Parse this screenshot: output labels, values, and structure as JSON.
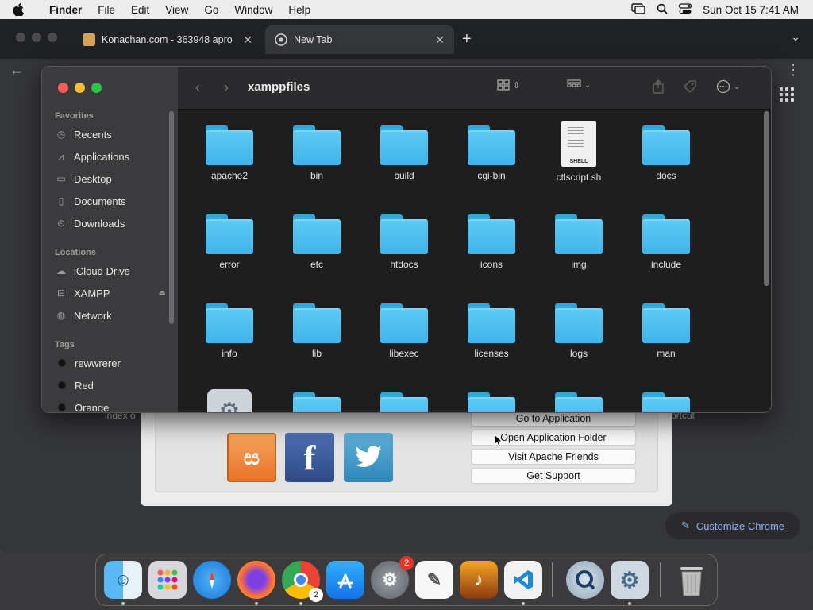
{
  "menubar": {
    "app_name": "Finder",
    "items": [
      "File",
      "Edit",
      "View",
      "Go",
      "Window",
      "Help"
    ],
    "datetime": "Sun Oct 15  7:41 AM"
  },
  "chrome": {
    "tabs": [
      {
        "title": "Konachan.com - 363948 apro",
        "active": false
      },
      {
        "title": "New Tab",
        "active": true
      }
    ],
    "ntp_left_text": "index o",
    "ntp_right_text": "ortcut",
    "customize_label": "Customize Chrome"
  },
  "finder": {
    "title": "xamppfiles",
    "sidebar": {
      "favorites_header": "Favorites",
      "favorites": [
        "Recents",
        "Applications",
        "Desktop",
        "Documents",
        "Downloads"
      ],
      "locations_header": "Locations",
      "locations": [
        "iCloud Drive",
        "XAMPP",
        "Network"
      ],
      "tags_header": "Tags",
      "tags": [
        "rewwrerer",
        "Red",
        "Orange"
      ]
    },
    "items": [
      {
        "name": "apache2",
        "kind": "folder"
      },
      {
        "name": "bin",
        "kind": "folder"
      },
      {
        "name": "build",
        "kind": "folder"
      },
      {
        "name": "cgi-bin",
        "kind": "folder"
      },
      {
        "name": "ctlscript.sh",
        "kind": "shell"
      },
      {
        "name": "docs",
        "kind": "folder"
      },
      {
        "name": "error",
        "kind": "folder"
      },
      {
        "name": "etc",
        "kind": "folder"
      },
      {
        "name": "htdocs",
        "kind": "folder"
      },
      {
        "name": "icons",
        "kind": "folder"
      },
      {
        "name": "img",
        "kind": "folder"
      },
      {
        "name": "include",
        "kind": "folder"
      },
      {
        "name": "info",
        "kind": "folder"
      },
      {
        "name": "lib",
        "kind": "folder"
      },
      {
        "name": "libexec",
        "kind": "folder"
      },
      {
        "name": "licenses",
        "kind": "folder"
      },
      {
        "name": "logs",
        "kind": "folder"
      },
      {
        "name": "man",
        "kind": "folder"
      }
    ],
    "shell_ext_label": "SHELL"
  },
  "xampp_panel": {
    "buttons": [
      "Go to Application",
      "Open Application Folder",
      "Visit Apache Friends",
      "Get Support"
    ]
  },
  "dock": {
    "apps": [
      "Finder",
      "Launchpad",
      "Safari",
      "Firefox",
      "Chrome",
      "App Store",
      "System Settings",
      "TextEdit",
      "GarageBand",
      "Visual Studio Code",
      "QuickTime Player",
      "XAMPP Manager",
      "Trash"
    ],
    "chrome_badge": "2",
    "settings_badge": "2"
  }
}
